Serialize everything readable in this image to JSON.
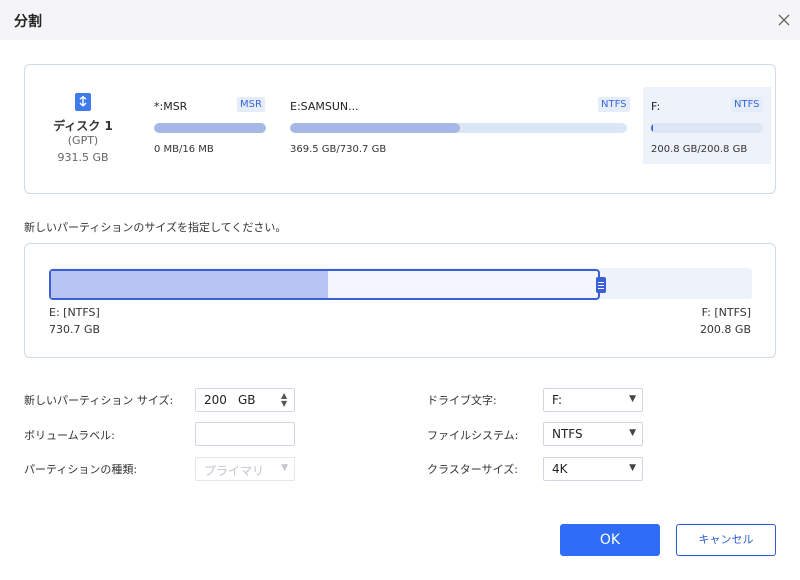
{
  "dialog": {
    "title": "分割"
  },
  "disk": {
    "name": "ディスク 1",
    "type": "(GPT)",
    "size": "931.5 GB",
    "partitions": [
      {
        "label": "*:MSR",
        "fs": "MSR",
        "usage": "0 MB/16 MB",
        "used_fraction": 1.0,
        "selected": false
      },
      {
        "label": "E:SAMSUN...",
        "fs": "NTFS",
        "usage": "369.5 GB/730.7 GB",
        "used_fraction": 0.5057,
        "selected": false
      },
      {
        "label": "F:",
        "fs": "NTFS",
        "usage": "200.8 GB/200.8 GB",
        "used_fraction": 0.02,
        "selected": true
      }
    ]
  },
  "instruction": "新しいパーティションのサイズを指定してください。",
  "resize": {
    "left_name": "E: [NTFS]",
    "left_size": "730.7 GB",
    "right_name": "F: [NTFS]",
    "right_size": "200.8 GB",
    "left_used_fraction": 0.5057,
    "split_fraction": 0.7844
  },
  "form": {
    "size_label": "新しいパーティション サイズ:",
    "size_value": "200",
    "size_unit": "GB",
    "volume_label_label": "ボリュームラベル:",
    "volume_label_value": "",
    "partition_type_label": "パーティションの種類:",
    "partition_type_value": "プライマリ",
    "drive_letter_label": "ドライブ文字:",
    "drive_letter_value": "F:",
    "filesystem_label": "ファイルシステム:",
    "filesystem_value": "NTFS",
    "cluster_size_label": "クラスターサイズ:",
    "cluster_size_value": "4K"
  },
  "buttons": {
    "ok": "OK",
    "cancel": "キャンセル"
  },
  "colors": {
    "accent": "#2f6df6",
    "bar_fill": "#a8b8e6",
    "bar_track": "#dde6f5",
    "tag_text": "#3b66d8"
  }
}
